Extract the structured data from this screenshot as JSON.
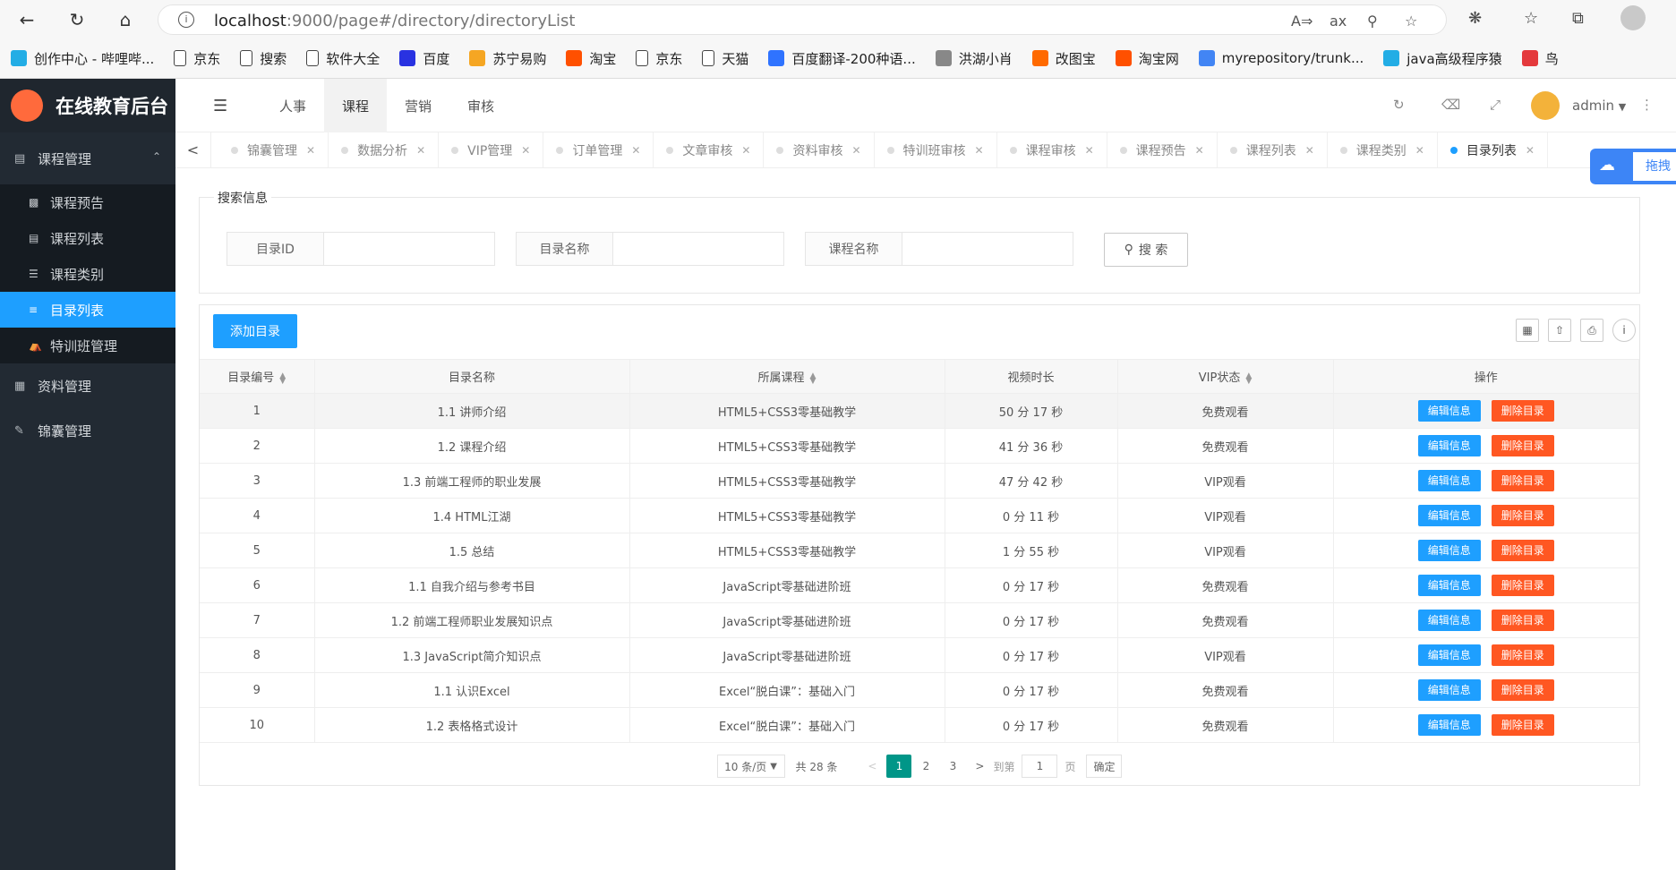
{
  "browser": {
    "url_host": "localhost",
    "url_rest": ":9000/page#/directory/directoryList",
    "bookmarks": [
      {
        "label": "创作中心 - 哔哩哔...",
        "color": "#23ade5"
      },
      {
        "label": "京东",
        "color": "#ffffff"
      },
      {
        "label": "搜索",
        "color": "#ffffff"
      },
      {
        "label": "软件大全",
        "color": "#ffffff"
      },
      {
        "label": "百度",
        "color": "#2932e1"
      },
      {
        "label": "苏宁易购",
        "color": "#f5a623"
      },
      {
        "label": "淘宝",
        "color": "#ff5000"
      },
      {
        "label": "京东",
        "color": "#ffffff"
      },
      {
        "label": "天猫",
        "color": "#ffffff"
      },
      {
        "label": "百度翻译-200种语...",
        "color": "#2f73ff"
      },
      {
        "label": "洪湖小肖",
        "color": "#888888"
      },
      {
        "label": "改图宝",
        "color": "#ff6a00"
      },
      {
        "label": "淘宝网",
        "color": "#ff5000"
      },
      {
        "label": "myrepository/trunk...",
        "color": "#4285f4"
      },
      {
        "label": "java高级程序猿",
        "color": "#23ade5"
      },
      {
        "label": "鸟",
        "color": "#e4393c"
      }
    ]
  },
  "sidebar": {
    "logo_text": "在线教育后台",
    "groups": [
      {
        "label": "课程管理",
        "expanded": true,
        "items": [
          {
            "label": "课程预告",
            "active": false
          },
          {
            "label": "课程列表",
            "active": false
          },
          {
            "label": "课程类别",
            "active": false
          },
          {
            "label": "目录列表",
            "active": true
          },
          {
            "label": "特训班管理",
            "active": false
          }
        ]
      },
      {
        "label": "资料管理"
      },
      {
        "label": "锦囊管理"
      }
    ]
  },
  "topnav": {
    "items": [
      "人事",
      "课程",
      "营销",
      "审核"
    ],
    "active_index": 1,
    "user": "admin"
  },
  "tabs": [
    "锦囊管理",
    "数据分析",
    "VIP管理",
    "订单管理",
    "文章审核",
    "资料审核",
    "特训班审核",
    "课程审核",
    "课程预告",
    "课程列表",
    "课程类别",
    "目录列表"
  ],
  "baidu_widget": "拖拽",
  "search": {
    "legend": "搜索信息",
    "fields": [
      "目录ID",
      "目录名称",
      "课程名称"
    ],
    "button": "搜 索"
  },
  "table": {
    "add_button": "添加目录",
    "headers": [
      "目录编号",
      "目录名称",
      "所属课程",
      "视频时长",
      "VIP状态",
      "操作"
    ],
    "edit_label": "编辑信息",
    "delete_label": "删除目录",
    "rows": [
      [
        "1",
        "1.1 讲师介绍",
        "HTML5+CSS3零基础教学",
        "50 分 17 秒",
        "免费观看"
      ],
      [
        "2",
        "1.2 课程介绍",
        "HTML5+CSS3零基础教学",
        "41 分 36 秒",
        "免费观看"
      ],
      [
        "3",
        "1.3 前端工程师的职业发展",
        "HTML5+CSS3零基础教学",
        "47 分 42 秒",
        "VIP观看"
      ],
      [
        "4",
        "1.4 HTML江湖",
        "HTML5+CSS3零基础教学",
        "0 分 11 秒",
        "VIP观看"
      ],
      [
        "5",
        "1.5 总结",
        "HTML5+CSS3零基础教学",
        "1 分 55 秒",
        "VIP观看"
      ],
      [
        "6",
        "1.1 自我介绍与参考书目",
        "JavaScript零基础进阶班",
        "0 分 17 秒",
        "免费观看"
      ],
      [
        "7",
        "1.2 前端工程师职业发展知识点",
        "JavaScript零基础进阶班",
        "0 分 17 秒",
        "免费观看"
      ],
      [
        "8",
        "1.3 JavaScript简介知识点",
        "JavaScript零基础进阶班",
        "0 分 17 秒",
        "VIP观看"
      ],
      [
        "9",
        "1.1 认识Excel",
        "Excel“脱白课”：基础入门",
        "0 分 17 秒",
        "免费观看"
      ],
      [
        "10",
        "1.2 表格格式设计",
        "Excel“脱白课”：基础入门",
        "0 分 17 秒",
        "免费观看"
      ]
    ]
  },
  "pager": {
    "page_size": "10 条/页",
    "total": "共 28 条",
    "pages": [
      "1",
      "2",
      "3"
    ],
    "current": "1",
    "goto_label": "到第",
    "goto_value": "1",
    "page_unit": "页",
    "confirm": "确定"
  }
}
